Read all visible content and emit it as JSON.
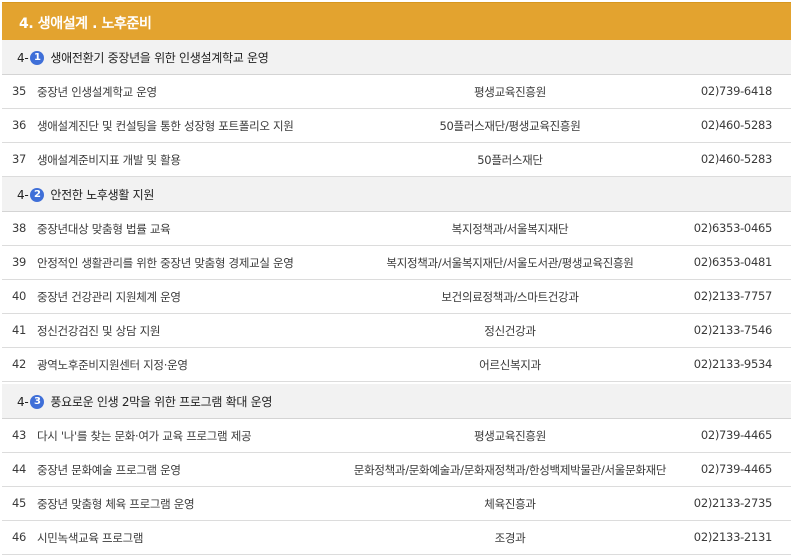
{
  "title": "4. 생애설계 . 노후준비",
  "sections": [
    {
      "prefix": "4-",
      "num": "1",
      "label": "생애전환기 중장년을 위한 인생설계학교 운영",
      "rows": [
        {
          "no": "35",
          "name": "중장년 인생설계학교 운영",
          "dept": "평생교육진흥원",
          "tel": "02)739-6418"
        },
        {
          "no": "36",
          "name": "생애설계진단 및 컨설팅을 통한 성장형 포트폴리오 지원",
          "dept": "50플러스재단/평생교육진흥원",
          "tel": "02)460-5283"
        },
        {
          "no": "37",
          "name": "생애설계준비지표 개발 및 활용",
          "dept": "50플러스재단",
          "tel": "02)460-5283"
        }
      ]
    },
    {
      "prefix": "4-",
      "num": "2",
      "label": "안전한 노후생활 지원",
      "rows": [
        {
          "no": "38",
          "name": "중장년대상 맞춤형 법률 교육",
          "dept": "복지정책과/서울복지재단",
          "tel": "02)6353-0465"
        },
        {
          "no": "39",
          "name": "안정적인 생활관리를 위한 중장년 맞춤형 경제교실 운영",
          "dept": "복지정책과/서울복지재단/서울도서관/평생교육진흥원",
          "tel": "02)6353-0481"
        },
        {
          "no": "40",
          "name": "중장년 건강관리 지원체계 운영",
          "dept": "보건의료정책과/스마트건강과",
          "tel": "02)2133-7757"
        },
        {
          "no": "41",
          "name": "정신건강검진 및 상담 지원",
          "dept": "정신건강과",
          "tel": "02)2133-7546"
        },
        {
          "no": "42",
          "name": "광역노후준비지원센터 지정·운영",
          "dept": "어르신복지과",
          "tel": "02)2133-9534"
        }
      ]
    },
    {
      "prefix": "4-",
      "num": "3",
      "label": "풍요로운 인생 2막을 위한 프로그램 확대 운영",
      "rows": [
        {
          "no": "43",
          "name": "다시 '나'를 찾는 문화·여가 교육 프로그램 제공",
          "dept": "평생교육진흥원",
          "tel": "02)739-4465"
        },
        {
          "no": "44",
          "name": "중장년 문화예술 프로그램 운영",
          "dept": "문화정책과/문화예술과/문화재정책과/한성백제박물관/서울문화재단",
          "tel": "02)739-4465"
        },
        {
          "no": "45",
          "name": "중장년 맞춤형 체육 프로그램 운영",
          "dept": "체육진흥과",
          "tel": "02)2133-2735"
        },
        {
          "no": "46",
          "name": "시민녹색교육 프로그램",
          "dept": "조경과",
          "tel": "02)2133-2131"
        }
      ]
    }
  ]
}
